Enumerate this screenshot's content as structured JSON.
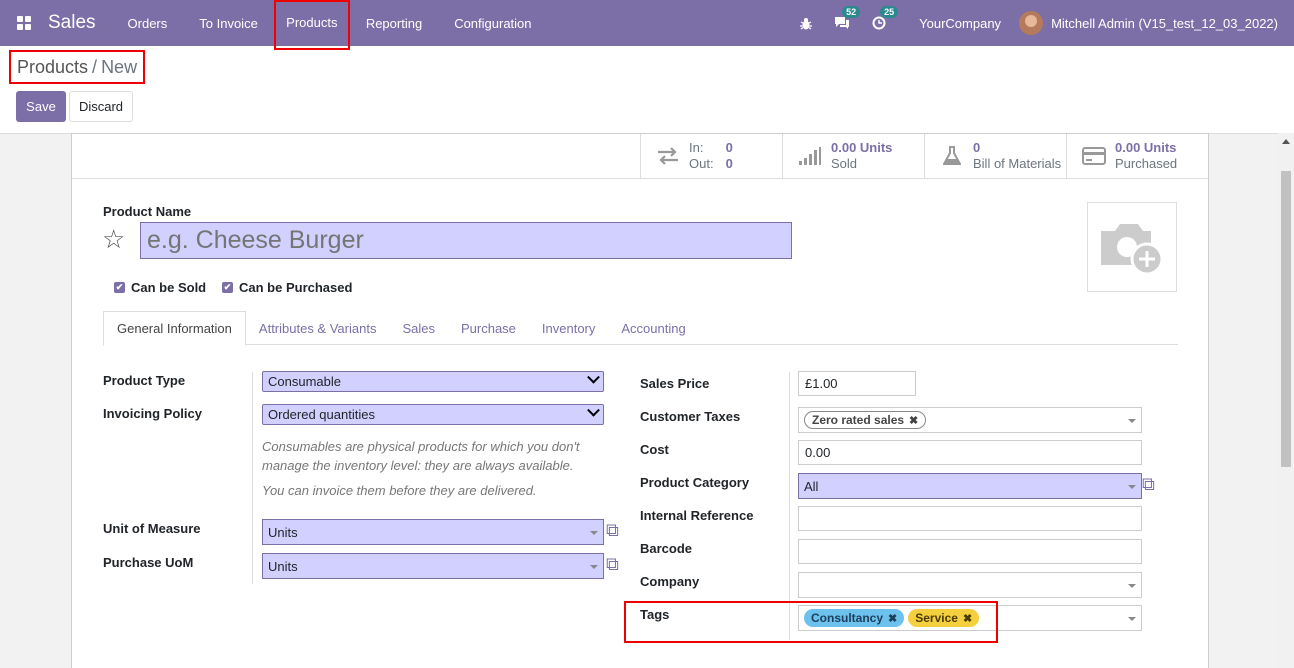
{
  "nav": {
    "app": "Sales",
    "menu": [
      "Orders",
      "To Invoice",
      "Products",
      "Reporting",
      "Configuration"
    ],
    "chat_badge": "52",
    "activity_badge": "25",
    "company": "YourCompany",
    "user": "Mitchell Admin (V15_test_12_03_2022)"
  },
  "breadcrumb": {
    "parent": "Products",
    "sep": "/",
    "current": "New"
  },
  "buttons": {
    "save": "Save",
    "discard": "Discard"
  },
  "stats": [
    {
      "icon": "transfer-arrows-icon",
      "l1": "In:",
      "v1": "0",
      "l2": "Out:",
      "v2": "0"
    },
    {
      "icon": "signal-bars-icon",
      "v": "0.00 Units",
      "l": "Sold"
    },
    {
      "icon": "flask-icon",
      "v": "0",
      "l": "Bill of Materials"
    },
    {
      "icon": "credit-card-icon",
      "v": "0.00 Units",
      "l": "Purchased"
    }
  ],
  "form": {
    "name_label": "Product Name",
    "name_placeholder": "e.g. Cheese Burger",
    "can_be_sold": "Can be Sold",
    "can_be_purchased": "Can be Purchased",
    "tabs": [
      "General Information",
      "Attributes & Variants",
      "Sales",
      "Purchase",
      "Inventory",
      "Accounting"
    ],
    "product_type_label": "Product Type",
    "product_type": "Consumable",
    "invoicing_policy_label": "Invoicing Policy",
    "invoicing_policy": "Ordered quantities",
    "help1": "Consumables are physical products for which you don't manage the inventory level: they are always available.",
    "help2": "You can invoice them before they are delivered.",
    "uom_label": "Unit of Measure",
    "uom": "Units",
    "puom_label": "Purchase UoM",
    "puom": "Units",
    "sales_price_label": "Sales Price",
    "sales_price": "£1.00",
    "customer_taxes_label": "Customer Taxes",
    "customer_tax_tag": "Zero rated sales",
    "cost_label": "Cost",
    "cost": "0.00",
    "category_label": "Product Category",
    "category": "All",
    "internal_ref_label": "Internal Reference",
    "barcode_label": "Barcode",
    "company_label": "Company",
    "tags_label": "Tags",
    "tags": [
      "Consultancy",
      "Service"
    ]
  }
}
